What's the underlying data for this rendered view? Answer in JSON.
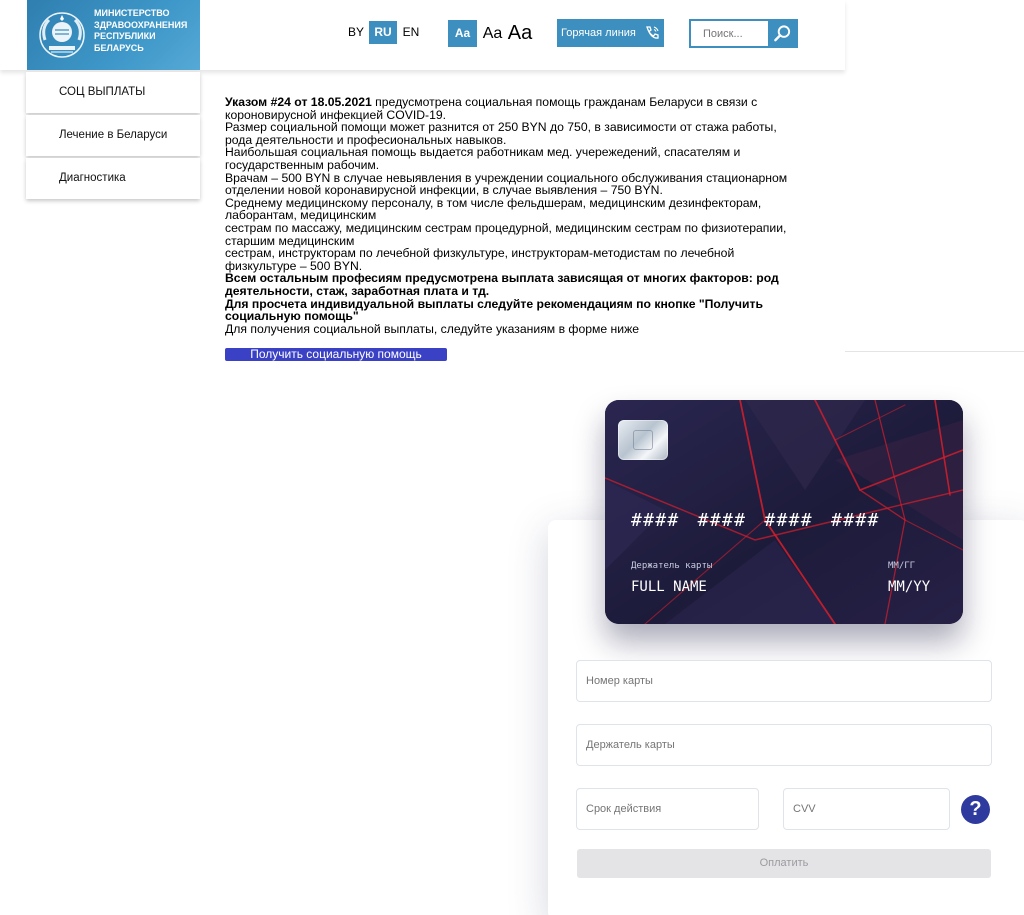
{
  "header": {
    "logo_lines": [
      "МИНИСТЕРСТВО",
      "ЗДРАВООХРАНЕНИЯ",
      "РЕСПУБЛИКИ",
      "БЕЛАРУСЬ"
    ],
    "languages": [
      {
        "label": "BY",
        "active": false
      },
      {
        "label": "RU",
        "active": true
      },
      {
        "label": "EN",
        "active": false
      }
    ],
    "font_sizes": [
      "Aa",
      "Aa",
      "Aa"
    ],
    "hotline_label": "Горячая линия",
    "search_placeholder": "Поиск..."
  },
  "sidebar": {
    "items": [
      {
        "label": "СОЦ ВЫПЛАТЫ"
      },
      {
        "label": "Лечение в Беларуси"
      },
      {
        "label": "Диагностика"
      }
    ]
  },
  "main": {
    "paragraphs": [
      {
        "bold": "Указом #24 от 18.05.2021",
        "text": " предусмотрена социальная помощь гражданам Беларуси в связи с короновирусной инфекцией COVID-19."
      },
      {
        "bold": "",
        "text": "Размер социальной помощи может разнится от 250 BYN до 750, в зависимости от стажа работы, рода деятельности и професиональных навыков."
      },
      {
        "bold": "",
        "text": "Наибольшая социальная помощь выдается работникам мед. учережедений, спасателям и государственным рабочим."
      },
      {
        "bold": "",
        "text": "Врачам – 500 BYN в случае невыявления в учреждении социального обслуживания стационарном отделении новой коронавирусной инфекции, в случае выявления – 750 BYN."
      },
      {
        "bold": "",
        "text": "Среднему медицинскому персоналу, в том числе фельдшерам, медицинским дезинфекторам, лаборантам, медицинским"
      },
      {
        "bold": "",
        "text": "сестрам по массажу, медицинским сестрам процедурной, медицинским сестрам по физиотерапии, старшим медицинским"
      },
      {
        "bold": "",
        "text": "сестрам, инструкторам по лечебной физкультуре, инструкторам-методистам по лечебной физкультуре – 500 BYN."
      },
      {
        "bold": "Всем остальным професиям предусмотрена выплата зависящая от многих факторов: род деятельности, стаж, заработная плата и тд.",
        "text": ""
      },
      {
        "bold": "Для просчета индивидуальной выплаты следуйте рекомендациям по кнопке \"Получить социальную помощь\"",
        "text": ""
      },
      {
        "bold": "",
        "text": "Для получения социальной выплаты, следуйте указаниям в форме ниже"
      }
    ],
    "help_button_label": "Получить социальную помощь"
  },
  "card": {
    "number": "#### #### #### ####",
    "holder_label": "Держатель карты",
    "holder_value": "FULL NAME",
    "expiry_label": "ММ/ГГ",
    "expiry_value": "MM/YY"
  },
  "form": {
    "card_number_placeholder": "Номер карты",
    "card_holder_placeholder": "Держатель карты",
    "expiry_placeholder": "Срок действия",
    "cvv_placeholder": "CVV",
    "help_glyph": "?",
    "pay_button_label": "Оплатить"
  },
  "colors": {
    "accent": "#3d8fbf",
    "help_button": "#3b41c4",
    "card_bg": "#1f1d3d",
    "help_icon": "#2f3a9e"
  }
}
